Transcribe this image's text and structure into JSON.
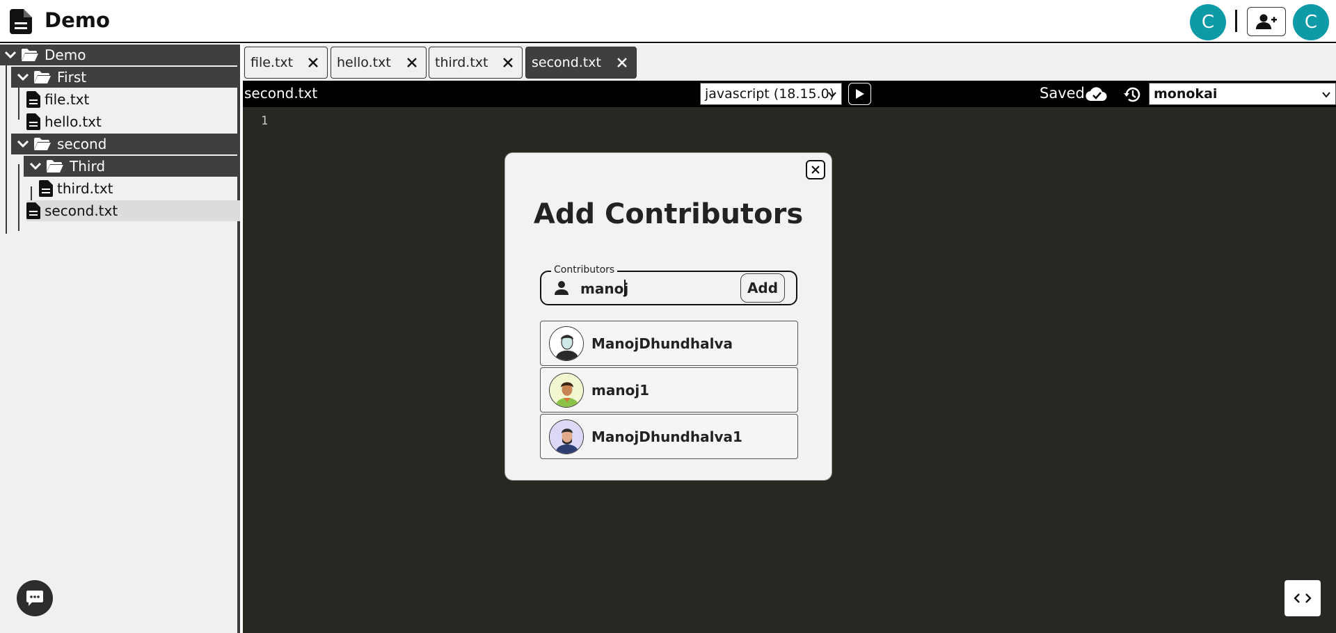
{
  "header": {
    "app_title": "Demo",
    "avatar_left_initial": "C",
    "avatar_right_initial": "C",
    "accent_color": "#0e9aa7"
  },
  "sidebar": {
    "tree": [
      {
        "type": "folder",
        "label": "Demo",
        "depth": 0
      },
      {
        "type": "folder",
        "label": "First",
        "depth": 1
      },
      {
        "type": "file",
        "label": "file.txt",
        "depth": 2
      },
      {
        "type": "file",
        "label": "hello.txt",
        "depth": 2
      },
      {
        "type": "folder",
        "label": "second",
        "depth": 1
      },
      {
        "type": "folder",
        "label": "Third",
        "depth": 2
      },
      {
        "type": "file",
        "label": "third.txt",
        "depth": 3
      },
      {
        "type": "file",
        "label": "second.txt",
        "depth": 2,
        "selected": true
      }
    ]
  },
  "tabs": [
    {
      "label": "file.txt",
      "active": false
    },
    {
      "label": "hello.txt",
      "active": false
    },
    {
      "label": "third.txt",
      "active": false
    },
    {
      "label": "second.txt",
      "active": true
    }
  ],
  "toolbar": {
    "file_name": "second.txt",
    "language": "javascript (18.15.0)",
    "status": "Saved",
    "theme": "monokai"
  },
  "editor": {
    "line_numbers": [
      "1"
    ],
    "background": "#272822"
  },
  "modal": {
    "title": "Add Contributors",
    "field_legend": "Contributors",
    "field_value": "manoj",
    "add_label": "Add",
    "results": [
      {
        "name": "ManojDhundhalva"
      },
      {
        "name": "manoj1"
      },
      {
        "name": "ManojDhundhalva1"
      }
    ]
  }
}
